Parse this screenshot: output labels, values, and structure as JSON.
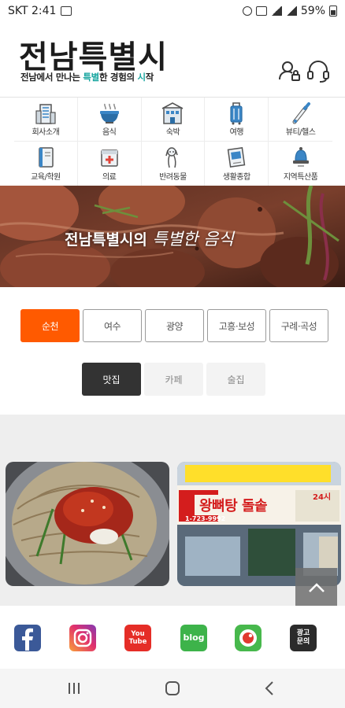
{
  "status_bar": {
    "carrier_time": "SKT 2:41",
    "battery": "59%"
  },
  "header": {
    "title": "전남특별시",
    "subtitle_parts": [
      "전남에서 만나는 ",
      "특별",
      "한 경험의 ",
      "시",
      "작"
    ],
    "accent_color": "#1aa6a0"
  },
  "categories": [
    {
      "label": "회사소개",
      "icon": "building-icon"
    },
    {
      "label": "음식",
      "icon": "food-bowl-icon"
    },
    {
      "label": "숙박",
      "icon": "hotel-icon"
    },
    {
      "label": "여행",
      "icon": "suitcase-icon"
    },
    {
      "label": "뷰티/헬스",
      "icon": "beauty-pen-icon"
    },
    {
      "label": "교육/학원",
      "icon": "book-icon"
    },
    {
      "label": "의료",
      "icon": "medical-cross-icon"
    },
    {
      "label": "반려동물",
      "icon": "dog-icon"
    },
    {
      "label": "생활종합",
      "icon": "photo-frame-icon"
    },
    {
      "label": "지역특산품",
      "icon": "bell-gift-icon"
    }
  ],
  "banner": {
    "text_bold": "전남특별시의",
    "text_script": "특별한 음식"
  },
  "regions": {
    "items": [
      "순천",
      "여수",
      "광양",
      "고흥·보성",
      "구례·곡성"
    ],
    "selected": "순천",
    "active_color": "#ff5a00"
  },
  "place_types": {
    "items": [
      "맛집",
      "카페",
      "술집"
    ],
    "selected": "맛집"
  },
  "gallery": {
    "card_2_sign": "왕뼈탕 돌솥",
    "card_2_phone": "1-723-9992",
    "card_2_hours": "24시"
  },
  "social": {
    "youtube_label": [
      "You",
      "Tube"
    ],
    "blog_label": "blog",
    "ad_label": [
      "광고",
      "문의"
    ]
  }
}
